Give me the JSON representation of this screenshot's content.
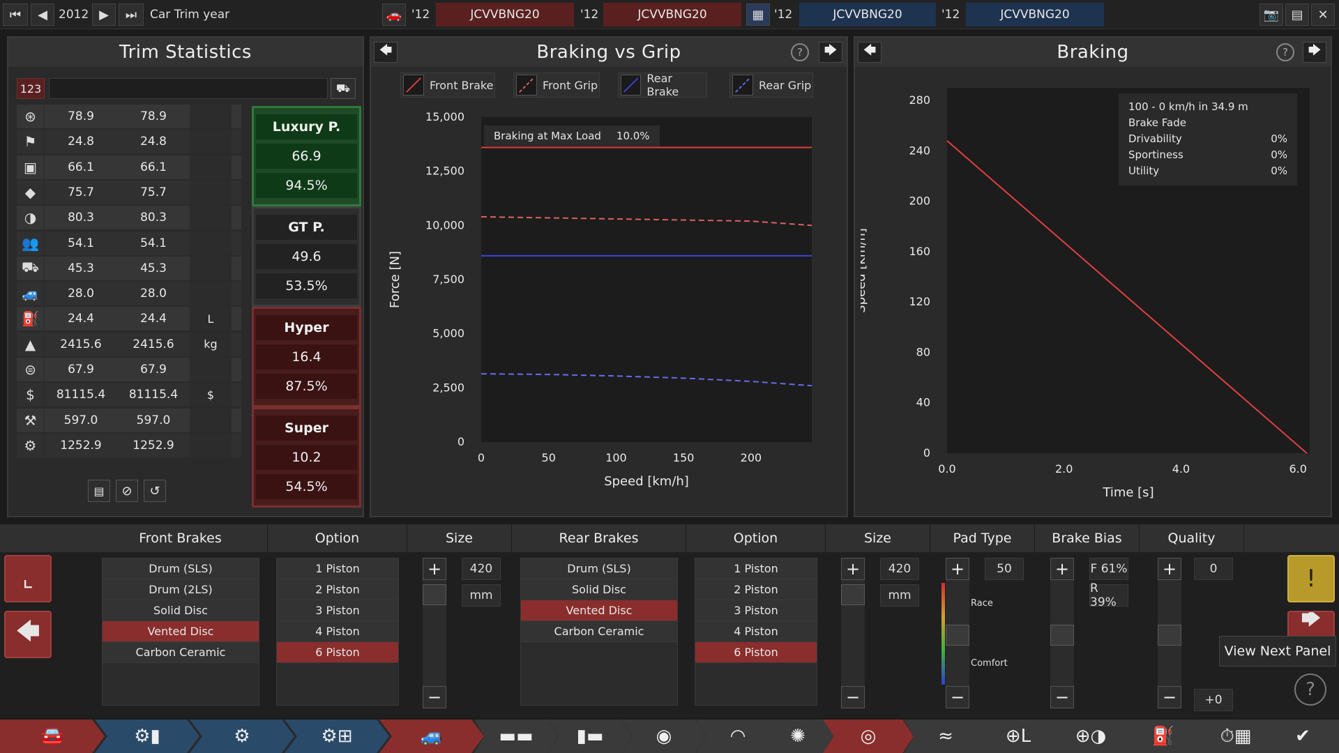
{
  "topbar": {
    "year": "2012",
    "year_label": "Car Trim year",
    "vehicles": [
      {
        "year": "'12",
        "name": "JCVVBNG20"
      },
      {
        "year": "'12",
        "name": "JCVVBNG20"
      },
      {
        "year": "'12",
        "name": "JCVVBNG20"
      },
      {
        "year": "'12",
        "name": "JCVVBNG20"
      }
    ]
  },
  "trim_stats": {
    "title": "Trim Statistics",
    "number_label": "123",
    "rows": [
      {
        "icon": "steering-icon",
        "a": "78.9",
        "b": "78.9",
        "unit": ""
      },
      {
        "icon": "race-flag-icon",
        "a": "24.8",
        "b": "24.8",
        "unit": ""
      },
      {
        "icon": "seat-icon",
        "a": "66.1",
        "b": "66.1",
        "unit": ""
      },
      {
        "icon": "diamond-icon",
        "a": "75.7",
        "b": "75.7",
        "unit": ""
      },
      {
        "icon": "half-circle-icon",
        "a": "80.3",
        "b": "80.3",
        "unit": ""
      },
      {
        "icon": "passengers-icon",
        "a": "54.1",
        "b": "54.1",
        "unit": ""
      },
      {
        "icon": "truck-icon",
        "a": "45.3",
        "b": "45.3",
        "unit": ""
      },
      {
        "icon": "offroad-car-icon",
        "a": "28.0",
        "b": "28.0",
        "unit": ""
      },
      {
        "icon": "fuel-can-icon",
        "a": "24.4",
        "b": "24.4",
        "unit": "L"
      },
      {
        "icon": "weight-icon",
        "a": "2415.6",
        "b": "2415.6",
        "unit": "kg"
      },
      {
        "icon": "piggy-bank-icon",
        "a": "67.9",
        "b": "67.9",
        "unit": ""
      },
      {
        "icon": "money-bag-icon",
        "a": "81115.4",
        "b": "81115.4",
        "unit": "$"
      },
      {
        "icon": "service-icon",
        "a": "597.0",
        "b": "597.0",
        "unit": ""
      },
      {
        "icon": "gear-hands-icon",
        "a": "1252.9",
        "b": "1252.9",
        "unit": ""
      }
    ],
    "categories": [
      {
        "name": "Luxury P.",
        "score": "66.9",
        "percent": "94.5%",
        "color": "#1d5a2a"
      },
      {
        "name": "GT P.",
        "score": "49.6",
        "percent": "53.5%",
        "color": "#333333"
      },
      {
        "name": "Hyper",
        "score": "16.4",
        "percent": "87.5%",
        "color": "#6b2626"
      },
      {
        "name": "Super",
        "score": "10.2",
        "percent": "54.5%",
        "color": "#6b2626"
      }
    ]
  },
  "braking_grip": {
    "title": "Braking vs Grip",
    "legend": [
      "Front Brake",
      "Front Grip",
      "Rear Brake",
      "Rear Grip"
    ],
    "annotation_label": "Braking at Max Load",
    "annotation_value": "10.0%",
    "chart_data": {
      "type": "line",
      "xlabel": "Speed [km/h]",
      "ylabel": "Force [N]",
      "xlim": [
        0,
        245
      ],
      "ylim": [
        0,
        15000
      ],
      "xticks": [
        "0",
        "50",
        "100",
        "150",
        "200"
      ],
      "yticks": [
        "0",
        "2,500",
        "5,000",
        "7,500",
        "10,000",
        "12,500",
        "15,000"
      ],
      "series": [
        {
          "name": "Front Brake",
          "color": "#e04040",
          "dashed": false,
          "x": [
            0,
            245
          ],
          "y": [
            13600,
            13600
          ]
        },
        {
          "name": "Front Grip",
          "color": "#e06060",
          "dashed": true,
          "x": [
            0,
            100,
            200,
            245
          ],
          "y": [
            10400,
            10300,
            10200,
            10000
          ]
        },
        {
          "name": "Rear Brake",
          "color": "#4040e0",
          "dashed": false,
          "x": [
            0,
            245
          ],
          "y": [
            8600,
            8600
          ]
        },
        {
          "name": "Rear Grip",
          "color": "#6a6af0",
          "dashed": true,
          "x": [
            0,
            50,
            100,
            150,
            200,
            245
          ],
          "y": [
            3150,
            3120,
            3050,
            2950,
            2800,
            2600
          ]
        }
      ]
    }
  },
  "braking": {
    "title": "Braking",
    "info": {
      "headline": "100 - 0 km/h in 34.9 m",
      "fade_label": "Brake Fade",
      "rows": [
        {
          "label": "Drivability",
          "value": "0%"
        },
        {
          "label": "Sportiness",
          "value": "0%"
        },
        {
          "label": "Utility",
          "value": "0%"
        }
      ]
    },
    "chart_data": {
      "type": "line",
      "xlabel": "Time [s]",
      "ylabel": "Speed [km/h]",
      "xlim": [
        0,
        6.2
      ],
      "ylim": [
        0,
        290
      ],
      "xticks": [
        "0.0",
        "2.0",
        "4.0",
        "6.0"
      ],
      "yticks": [
        "0",
        "40",
        "80",
        "120",
        "160",
        "200",
        "240",
        "280"
      ],
      "series": [
        {
          "name": "",
          "color": "#e04040",
          "x": [
            0,
            6.15
          ],
          "y": [
            248,
            0
          ]
        }
      ]
    }
  },
  "bottom": {
    "headers": [
      "Front Brakes",
      "Option",
      "Size",
      "Rear Brakes",
      "Option",
      "Size",
      "Pad Type",
      "Brake Bias",
      "Quality"
    ],
    "front_brakes": {
      "items": [
        "Drum (SLS)",
        "Drum (2LS)",
        "Solid Disc",
        "Vented Disc",
        "Carbon Ceramic"
      ],
      "selected": 3
    },
    "front_option": {
      "items": [
        "1 Piston",
        "2 Piston",
        "3 Piston",
        "4 Piston",
        "6 Piston"
      ],
      "selected": 4
    },
    "front_size": {
      "value": "420",
      "unit": "mm"
    },
    "rear_brakes": {
      "items": [
        "Drum (SLS)",
        "Solid Disc",
        "Vented Disc",
        "Carbon Ceramic"
      ],
      "selected": 2
    },
    "rear_option": {
      "items": [
        "1 Piston",
        "2 Piston",
        "3 Piston",
        "4 Piston",
        "6 Piston"
      ],
      "selected": 4
    },
    "rear_size": {
      "value": "420",
      "unit": "mm"
    },
    "pad_type": {
      "value": "50",
      "top_label": "Race",
      "bottom_label": "Comfort"
    },
    "brake_bias": {
      "front": "F 61%",
      "rear": "R 39%"
    },
    "quality": {
      "value": "0",
      "delta": "+0"
    },
    "tooltip": "View Next Panel"
  }
}
